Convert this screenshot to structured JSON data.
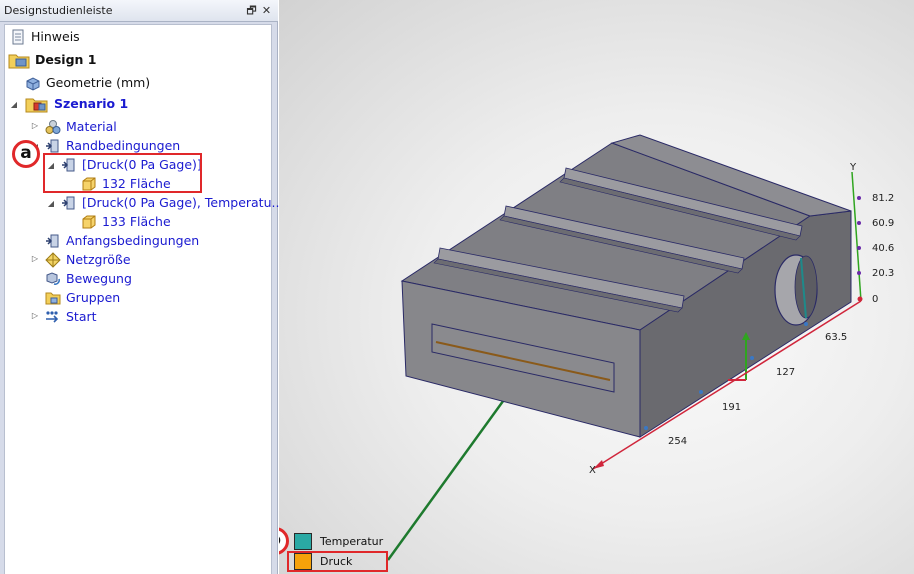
{
  "panel": {
    "title": "Designstudienleiste",
    "pin_glyph": "🗗",
    "close_glyph": "✕"
  },
  "tree": {
    "hint": "Hinweis",
    "design": "Design 1",
    "geometry": "Geometrie (mm)",
    "scenario": "Szenario 1",
    "material": "Material",
    "boundary": "Randbedingungen",
    "bc1": "[Druck(0 Pa Gage)]",
    "bc1_child": "132 Fläche",
    "bc2": "[Druck(0 Pa Gage), Temperatu...",
    "bc2_child": "133 Fläche",
    "initial": "Anfangsbedingungen",
    "mesh": "Netzgröße",
    "motion": "Bewegung",
    "groups": "Gruppen",
    "start": "Start"
  },
  "callouts": {
    "a": "a",
    "b": "b"
  },
  "legend": {
    "items": [
      {
        "label": "Temperatur",
        "color": "#2aa9a4"
      },
      {
        "label": "Druck",
        "color": "#f5a20a"
      }
    ]
  },
  "axes": {
    "x_label": "X",
    "y_label": "Y",
    "x_ticks": [
      "63.5",
      "127",
      "191",
      "254"
    ],
    "y_ticks": [
      "81.2",
      "60.9",
      "40.6",
      "20.3",
      "0"
    ]
  },
  "colors": {
    "link_blue": "#1a1ad0",
    "callout_red": "#e0282a",
    "x_axis": "#d0263c",
    "y_axis": "#2fa51f",
    "leader": "#1e7a2e"
  }
}
